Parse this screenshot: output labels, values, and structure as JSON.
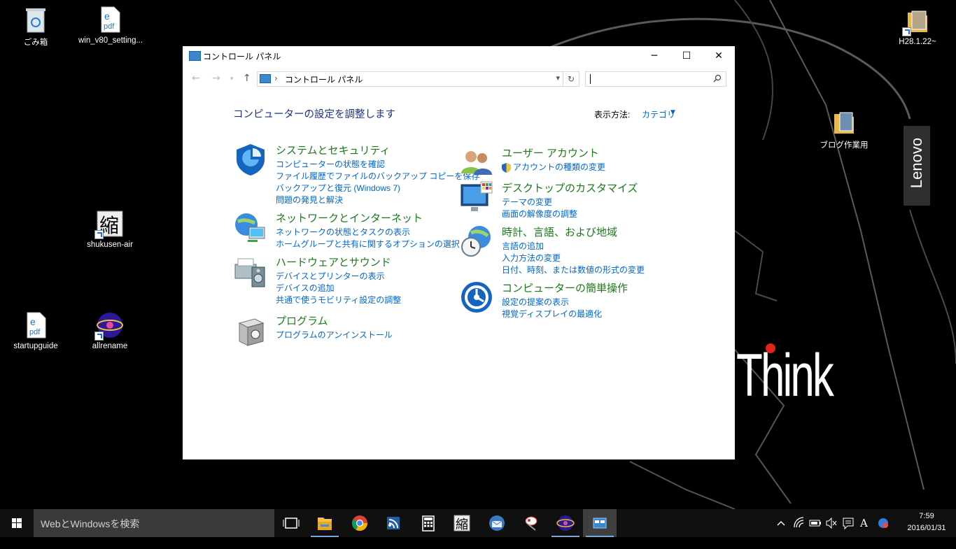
{
  "desktop": {
    "icons": [
      {
        "label": "ごみ箱"
      },
      {
        "label": "win_v80_setting..."
      },
      {
        "label": "shukusen-air"
      },
      {
        "label": "startupguide"
      },
      {
        "label": "allrename"
      },
      {
        "label": "H28.1.22~"
      },
      {
        "label": "ブログ作業用"
      }
    ],
    "wallpaper_text": "Think",
    "brand": "Lenovo",
    "shukusen_glyph": "縮",
    "pdf_text": "pdf"
  },
  "window": {
    "title": "コントロール パネル",
    "address": {
      "path": "コントロール パネル"
    },
    "search": {
      "placeholder": ""
    },
    "heading": "コンピューターの設定を調整します",
    "view_by_label": "表示方法:",
    "view_by_value": "カテゴリ",
    "categories": [
      {
        "title": "システムとセキュリティ",
        "links": [
          "コンピューターの状態を確認",
          "ファイル履歴でファイルのバックアップ コピーを保存",
          "バックアップと復元 (Windows 7)",
          "問題の発見と解決"
        ]
      },
      {
        "title": "ネットワークとインターネット",
        "links": [
          "ネットワークの状態とタスクの表示",
          "ホームグループと共有に関するオプションの選択"
        ]
      },
      {
        "title": "ハードウェアとサウンド",
        "links": [
          "デバイスとプリンターの表示",
          "デバイスの追加",
          "共通で使うモビリティ設定の調整"
        ]
      },
      {
        "title": "プログラム",
        "links": [
          "プログラムのアンインストール"
        ]
      },
      {
        "title": "ユーザー アカウント",
        "links": [
          "アカウントの種類の変更"
        ]
      },
      {
        "title": "デスクトップのカスタマイズ",
        "links": [
          "テーマの変更",
          "画面の解像度の調整"
        ]
      },
      {
        "title": "時計、言語、および地域",
        "links": [
          "言語の追加",
          "入力方法の変更",
          "日付、時刻、または数値の形式の変更"
        ]
      },
      {
        "title": "コンピューターの簡単操作",
        "links": [
          "設定の提案の表示",
          "視覚ディスプレイの最適化"
        ]
      }
    ]
  },
  "taskbar": {
    "search_placeholder": "WebとWindowsを検索",
    "apps": [
      "task-view",
      "file-explorer",
      "chrome",
      "rss-reader",
      "calculator",
      "shukusen",
      "thunderbird",
      "paint-tool",
      "allrename",
      "control-panel"
    ],
    "ime_indicator": "A",
    "clock": {
      "time": "7:59",
      "date": "2016/01/31"
    }
  },
  "colors": {
    "category_title": "#1a7a1a",
    "link": "#0066cc",
    "heading": "#1e3287",
    "taskbar": "#101010"
  }
}
